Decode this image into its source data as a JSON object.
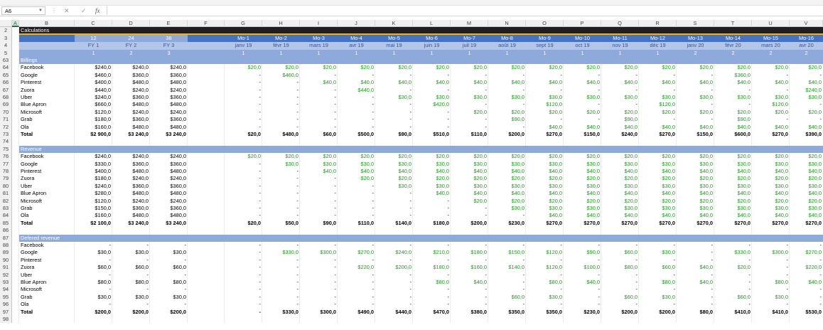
{
  "formula_bar": {
    "name_box": "A6",
    "cancel_icon": "✕",
    "enter_icon": "✓",
    "fx_label": "fx",
    "formula": ""
  },
  "selected_cell": {
    "col": "A",
    "row": "6"
  },
  "colors": {
    "header_dark": "#1e1e1e",
    "gold": "#f0b21c",
    "blue": "#4472c4",
    "light_blue": "#8ea9db",
    "pale_blue": "#b4c6e7",
    "green_value": "#1f9a1f"
  },
  "columns": [
    "A",
    "B",
    "C",
    "D",
    "E",
    "F",
    "G",
    "H",
    "I",
    "J",
    "K",
    "L",
    "M",
    "N",
    "O",
    "P",
    "Q",
    "R",
    "S",
    "T",
    "U",
    "V"
  ],
  "header_rows": {
    "row2_label": "Calculations",
    "row3": [
      "12",
      "24",
      "36",
      "",
      "Mo-1",
      "Mo-2",
      "Mo-3",
      "Mo-4",
      "Mo-5",
      "Mo-6",
      "Mo-7",
      "Mo-8",
      "Mo-9",
      "Mo-10",
      "Mo-11",
      "Mo-12",
      "Mo-13",
      "Mo-14",
      "Mo-15",
      "Mo-16"
    ],
    "row4": [
      "FY 1",
      "FY 2",
      "FY 3",
      "",
      "janv 19",
      "févr 19",
      "mars 19",
      "avr 19",
      "mai 19",
      "juin 19",
      "juil 19",
      "août 19",
      "sept 19",
      "oct 19",
      "nov 19",
      "déc 19",
      "janv 20",
      "févr 20",
      "mars 20",
      "avr 20"
    ],
    "row5": [
      "1",
      "2",
      "3",
      "",
      "1",
      "1",
      "1",
      "1",
      "1",
      "1",
      "1",
      "1",
      "1",
      "1",
      "1",
      "1",
      "2",
      "2",
      "2",
      "2"
    ]
  },
  "sections": [
    {
      "title_row": "63",
      "title": "Billings",
      "rows": [
        {
          "n": "64",
          "label": "Facebook",
          "fy": [
            "$240,0",
            "$240,0",
            "$240,0"
          ],
          "m": [
            "$20,0",
            "$20,0",
            "$20,0",
            "$20,0",
            "$20,0",
            "$20,0",
            "$20,0",
            "$20,0",
            "$20,0",
            "$20,0",
            "$20,0",
            "$20,0",
            "$20,0",
            "$20,0",
            "$20,0",
            "$20,0"
          ]
        },
        {
          "n": "65",
          "label": "Google",
          "fy": [
            "$460,0",
            "$360,0",
            "$360,0"
          ],
          "m": [
            "-",
            "$460,0",
            "-",
            "-",
            "-",
            "-",
            "-",
            "-",
            "-",
            "-",
            "-",
            "-",
            "-",
            "$360,0",
            "-",
            "-"
          ]
        },
        {
          "n": "66",
          "label": "Pinterest",
          "fy": [
            "$400,0",
            "$480,0",
            "$480,0"
          ],
          "m": [
            "-",
            "-",
            "$40,0",
            "$40,0",
            "$40,0",
            "$40,0",
            "$40,0",
            "$40,0",
            "$40,0",
            "$40,0",
            "$40,0",
            "$40,0",
            "$40,0",
            "$40,0",
            "$40,0",
            "$40,0"
          ]
        },
        {
          "n": "67",
          "label": "Zuora",
          "fy": [
            "$440,0",
            "$240,0",
            "$240,0"
          ],
          "m": [
            "-",
            "-",
            "-",
            "$440,0",
            "-",
            "-",
            "-",
            "-",
            "-",
            "-",
            "-",
            "-",
            "-",
            "-",
            "-",
            "$240,0"
          ]
        },
        {
          "n": "68",
          "label": "Uber",
          "fy": [
            "$240,0",
            "$360,0",
            "$360,0"
          ],
          "m": [
            "-",
            "-",
            "-",
            "-",
            "$30,0",
            "$30,0",
            "$30,0",
            "$30,0",
            "$30,0",
            "$30,0",
            "$30,0",
            "$30,0",
            "$30,0",
            "$30,0",
            "$30,0",
            "$30,0"
          ]
        },
        {
          "n": "69",
          "label": "Blue Apron",
          "fy": [
            "$660,0",
            "$480,0",
            "$480,0"
          ],
          "m": [
            "-",
            "-",
            "-",
            "-",
            "-",
            "$420,0",
            "-",
            "-",
            "$120,0",
            "-",
            "-",
            "$120,0",
            "-",
            "-",
            "$120,0",
            "-"
          ]
        },
        {
          "n": "70",
          "label": "Microsoft",
          "fy": [
            "$120,0",
            "$240,0",
            "$240,0"
          ],
          "m": [
            "-",
            "-",
            "-",
            "-",
            "-",
            "-",
            "$20,0",
            "$20,0",
            "$20,0",
            "$20,0",
            "$20,0",
            "$20,0",
            "$20,0",
            "$20,0",
            "$20,0",
            "$20,0"
          ]
        },
        {
          "n": "71",
          "label": "Grab",
          "fy": [
            "$180,0",
            "$360,0",
            "$360,0"
          ],
          "m": [
            "-",
            "-",
            "-",
            "-",
            "-",
            "-",
            "-",
            "$90,0",
            "-",
            "-",
            "$90,0",
            "-",
            "-",
            "$90,0",
            "-",
            "-"
          ]
        },
        {
          "n": "72",
          "label": "Ola",
          "fy": [
            "$160,0",
            "$480,0",
            "$480,0"
          ],
          "m": [
            "-",
            "-",
            "-",
            "-",
            "-",
            "-",
            "-",
            "-",
            "$40,0",
            "$40,0",
            "$40,0",
            "$40,0",
            "$40,0",
            "$40,0",
            "$40,0",
            "$40,0"
          ]
        }
      ],
      "total": {
        "n": "73",
        "label": "Total",
        "fy": [
          "$2 900,0",
          "$3 240,0",
          "$3 240,0"
        ],
        "m": [
          "$20,0",
          "$480,0",
          "$60,0",
          "$500,0",
          "$90,0",
          "$510,0",
          "$110,0",
          "$200,0",
          "$270,0",
          "$150,0",
          "$240,0",
          "$270,0",
          "$150,0",
          "$600,0",
          "$270,0",
          "$390,0"
        ]
      },
      "blank_row": "74"
    },
    {
      "title_row": "75",
      "title": "Revenue",
      "rows": [
        {
          "n": "76",
          "label": "Facebook",
          "fy": [
            "$240,0",
            "$240,0",
            "$240,0"
          ],
          "m": [
            "$20,0",
            "$20,0",
            "$20,0",
            "$20,0",
            "$20,0",
            "$20,0",
            "$20,0",
            "$20,0",
            "$20,0",
            "$20,0",
            "$20,0",
            "$20,0",
            "$20,0",
            "$20,0",
            "$20,0",
            "$20,0"
          ]
        },
        {
          "n": "77",
          "label": "Google",
          "fy": [
            "$330,0",
            "$360,0",
            "$360,0"
          ],
          "m": [
            "-",
            "$30,0",
            "$30,0",
            "$30,0",
            "$30,0",
            "$30,0",
            "$30,0",
            "$30,0",
            "$30,0",
            "$30,0",
            "$30,0",
            "$30,0",
            "$30,0",
            "$30,0",
            "$30,0",
            "$30,0"
          ]
        },
        {
          "n": "78",
          "label": "Pinterest",
          "fy": [
            "$400,0",
            "$480,0",
            "$480,0"
          ],
          "m": [
            "-",
            "-",
            "$40,0",
            "$40,0",
            "$40,0",
            "$40,0",
            "$40,0",
            "$40,0",
            "$40,0",
            "$40,0",
            "$40,0",
            "$40,0",
            "$40,0",
            "$40,0",
            "$40,0",
            "$40,0"
          ]
        },
        {
          "n": "79",
          "label": "Zuora",
          "fy": [
            "$180,0",
            "$240,0",
            "$240,0"
          ],
          "m": [
            "-",
            "-",
            "-",
            "$20,0",
            "$20,0",
            "$20,0",
            "$20,0",
            "$20,0",
            "$20,0",
            "$20,0",
            "$20,0",
            "$20,0",
            "$20,0",
            "$20,0",
            "$20,0",
            "$20,0"
          ]
        },
        {
          "n": "80",
          "label": "Uber",
          "fy": [
            "$240,0",
            "$360,0",
            "$360,0"
          ],
          "m": [
            "-",
            "-",
            "-",
            "-",
            "$30,0",
            "$30,0",
            "$30,0",
            "$30,0",
            "$30,0",
            "$30,0",
            "$30,0",
            "$30,0",
            "$30,0",
            "$30,0",
            "$30,0",
            "$30,0"
          ]
        },
        {
          "n": "81",
          "label": "Blue Apron",
          "fy": [
            "$280,0",
            "$480,0",
            "$480,0"
          ],
          "m": [
            "-",
            "-",
            "-",
            "-",
            "-",
            "$40,0",
            "$40,0",
            "$40,0",
            "$40,0",
            "$40,0",
            "$40,0",
            "$40,0",
            "$40,0",
            "$40,0",
            "$40,0",
            "$40,0"
          ]
        },
        {
          "n": "82",
          "label": "Microsoft",
          "fy": [
            "$120,0",
            "$240,0",
            "$240,0"
          ],
          "m": [
            "-",
            "-",
            "-",
            "-",
            "-",
            "-",
            "$20,0",
            "$20,0",
            "$20,0",
            "$20,0",
            "$20,0",
            "$20,0",
            "$20,0",
            "$20,0",
            "$20,0",
            "$20,0"
          ]
        },
        {
          "n": "83",
          "label": "Grab",
          "fy": [
            "$150,0",
            "$360,0",
            "$360,0"
          ],
          "m": [
            "-",
            "-",
            "-",
            "-",
            "-",
            "-",
            "-",
            "$30,0",
            "$30,0",
            "$30,0",
            "$30,0",
            "$30,0",
            "$30,0",
            "$30,0",
            "$30,0",
            "$30,0"
          ]
        },
        {
          "n": "84",
          "label": "Ola",
          "fy": [
            "$160,0",
            "$480,0",
            "$480,0"
          ],
          "m": [
            "-",
            "-",
            "-",
            "-",
            "-",
            "-",
            "-",
            "-",
            "$40,0",
            "$40,0",
            "$40,0",
            "$40,0",
            "$40,0",
            "$40,0",
            "$40,0",
            "$40,0"
          ]
        }
      ],
      "total": {
        "n": "85",
        "label": "Total",
        "fy": [
          "$2 100,0",
          "$3 240,0",
          "$3 240,0"
        ],
        "m": [
          "$20,0",
          "$50,0",
          "$90,0",
          "$110,0",
          "$140,0",
          "$180,0",
          "$200,0",
          "$230,0",
          "$270,0",
          "$270,0",
          "$270,0",
          "$270,0",
          "$270,0",
          "$270,0",
          "$270,0",
          "$270,0"
        ]
      },
      "blank_row": "86"
    },
    {
      "title_row": "87",
      "title": "Defered revenue",
      "rows": [
        {
          "n": "88",
          "label": "Facebook",
          "fy": [
            "-",
            "-",
            "-"
          ],
          "m": [
            "-",
            "-",
            "-",
            "-",
            "-",
            "-",
            "-",
            "-",
            "-",
            "-",
            "-",
            "-",
            "-",
            "-",
            "-",
            "-"
          ]
        },
        {
          "n": "89",
          "label": "Google",
          "fy": [
            "$30,0",
            "$30,0",
            "$30,0"
          ],
          "m": [
            "-",
            "$330,0",
            "$300,0",
            "$270,0",
            "$240,0",
            "$210,0",
            "$180,0",
            "$150,0",
            "$120,0",
            "$90,0",
            "$60,0",
            "$30,0",
            "-",
            "$330,0",
            "$300,0",
            "$270,0"
          ]
        },
        {
          "n": "90",
          "label": "Pinterest",
          "fy": [
            "-",
            "-",
            "-"
          ],
          "m": [
            "-",
            "-",
            "-",
            "-",
            "-",
            "-",
            "-",
            "-",
            "-",
            "-",
            "-",
            "-",
            "-",
            "-",
            "-",
            "-"
          ]
        },
        {
          "n": "91",
          "label": "Zuora",
          "fy": [
            "$60,0",
            "$60,0",
            "$60,0"
          ],
          "m": [
            "-",
            "-",
            "-",
            "$220,0",
            "$200,0",
            "$180,0",
            "$160,0",
            "$140,0",
            "$120,0",
            "$100,0",
            "$80,0",
            "$60,0",
            "$40,0",
            "$20,0",
            "-",
            "$220,0"
          ]
        },
        {
          "n": "92",
          "label": "Uber",
          "fy": [
            "-",
            "-",
            "-"
          ],
          "m": [
            "-",
            "-",
            "-",
            "-",
            "-",
            "-",
            "-",
            "-",
            "-",
            "-",
            "-",
            "-",
            "-",
            "-",
            "-",
            "-"
          ]
        },
        {
          "n": "93",
          "label": "Blue Apron",
          "fy": [
            "$80,0",
            "$80,0",
            "$80,0"
          ],
          "m": [
            "-",
            "-",
            "-",
            "-",
            "-",
            "$80,0",
            "$40,0",
            "-",
            "$80,0",
            "$40,0",
            "-",
            "$80,0",
            "$40,0",
            "-",
            "$80,0",
            "$40,0"
          ]
        },
        {
          "n": "94",
          "label": "Microsoft",
          "fy": [
            "-",
            "-",
            "-"
          ],
          "m": [
            "-",
            "-",
            "-",
            "-",
            "-",
            "-",
            "-",
            "-",
            "-",
            "-",
            "-",
            "-",
            "-",
            "-",
            "-",
            "-"
          ]
        },
        {
          "n": "95",
          "label": "Grab",
          "fy": [
            "$30,0",
            "$30,0",
            "$30,0"
          ],
          "m": [
            "-",
            "-",
            "-",
            "-",
            "-",
            "-",
            "-",
            "$60,0",
            "$30,0",
            "-",
            "$60,0",
            "$30,0",
            "-",
            "$60,0",
            "$30,0",
            "-"
          ]
        },
        {
          "n": "96",
          "label": "Ola",
          "fy": [
            "-",
            "-",
            "-"
          ],
          "m": [
            "-",
            "-",
            "-",
            "-",
            "-",
            "-",
            "-",
            "-",
            "-",
            "-",
            "-",
            "-",
            "-",
            "-",
            "-",
            "-"
          ]
        }
      ],
      "total": {
        "n": "97",
        "label": "Total",
        "fy": [
          "$200,0",
          "$200,0",
          "$200,0"
        ],
        "m": [
          "-",
          "$330,0",
          "$300,0",
          "$490,0",
          "$440,0",
          "$470,0",
          "$380,0",
          "$350,0",
          "$350,0",
          "$230,0",
          "$200,0",
          "$200,0",
          "$80,0",
          "$410,0",
          "$410,0",
          "$530,0"
        ]
      },
      "blank_row": "98"
    }
  ],
  "fixed_rows": {
    "col_header_row": "",
    "r1": "1",
    "r2": "2",
    "r3": "3",
    "r4": "4",
    "r5": "5"
  }
}
